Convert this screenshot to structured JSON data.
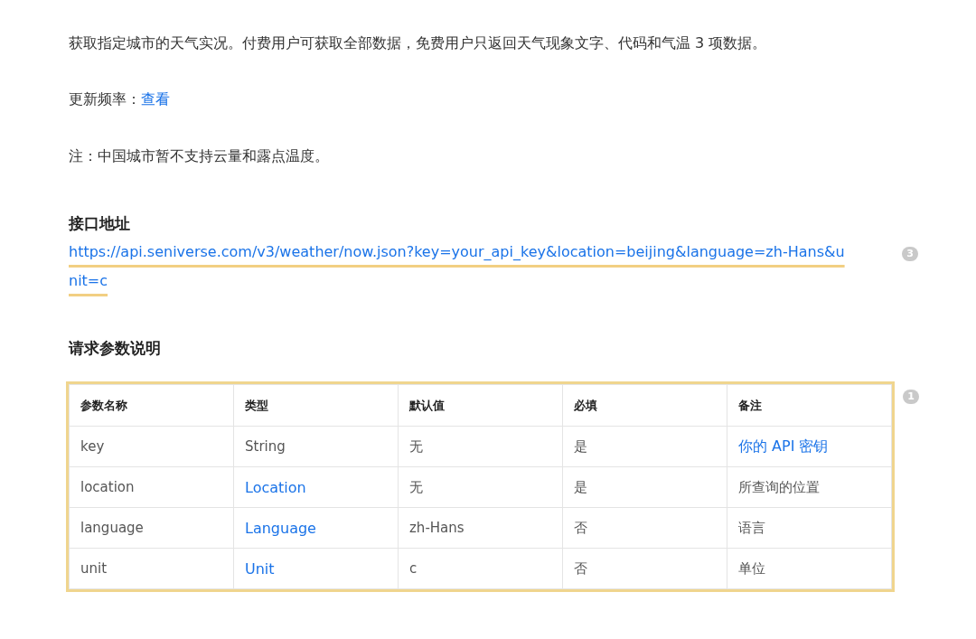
{
  "intro": "获取指定城市的天气实况。付费用户可获取全部数据，免费用户只返回天气现象文字、代码和气温 3 项数据。",
  "update": {
    "label": "更新频率：",
    "link": "查看"
  },
  "note": "注：中国城市暂不支持云量和露点温度。",
  "endpoint": {
    "heading": "接口地址",
    "url": "https://api.seniverse.com/v3/weather/now.json?key=your_api_key&location=beijing&language=zh-Hans&unit=c",
    "highlighted": true,
    "comment_count": "3"
  },
  "params": {
    "heading": "请求参数说明",
    "highlighted": true,
    "comment_count": "1",
    "columns": [
      "参数名称",
      "类型",
      "默认值",
      "必填",
      "备注"
    ],
    "rows": [
      [
        {
          "text": "key",
          "kind": "text"
        },
        {
          "text": "String",
          "kind": "text"
        },
        {
          "text": "无",
          "kind": "text"
        },
        {
          "text": "是",
          "kind": "text"
        },
        {
          "text": "你的 API 密钥",
          "kind": "link"
        }
      ],
      [
        {
          "text": "location",
          "kind": "text"
        },
        {
          "text": "Location",
          "kind": "link"
        },
        {
          "text": "无",
          "kind": "text"
        },
        {
          "text": "是",
          "kind": "text"
        },
        {
          "text": "所查询的位置",
          "kind": "text"
        }
      ],
      [
        {
          "text": "language",
          "kind": "text"
        },
        {
          "text": "Language",
          "kind": "link"
        },
        {
          "text": "zh-Hans",
          "kind": "text"
        },
        {
          "text": "否",
          "kind": "text"
        },
        {
          "text": "语言",
          "kind": "text"
        }
      ],
      [
        {
          "text": "unit",
          "kind": "text"
        },
        {
          "text": "Unit",
          "kind": "link"
        },
        {
          "text": "c",
          "kind": "text"
        },
        {
          "text": "否",
          "kind": "text"
        },
        {
          "text": "单位",
          "kind": "text"
        }
      ]
    ]
  }
}
